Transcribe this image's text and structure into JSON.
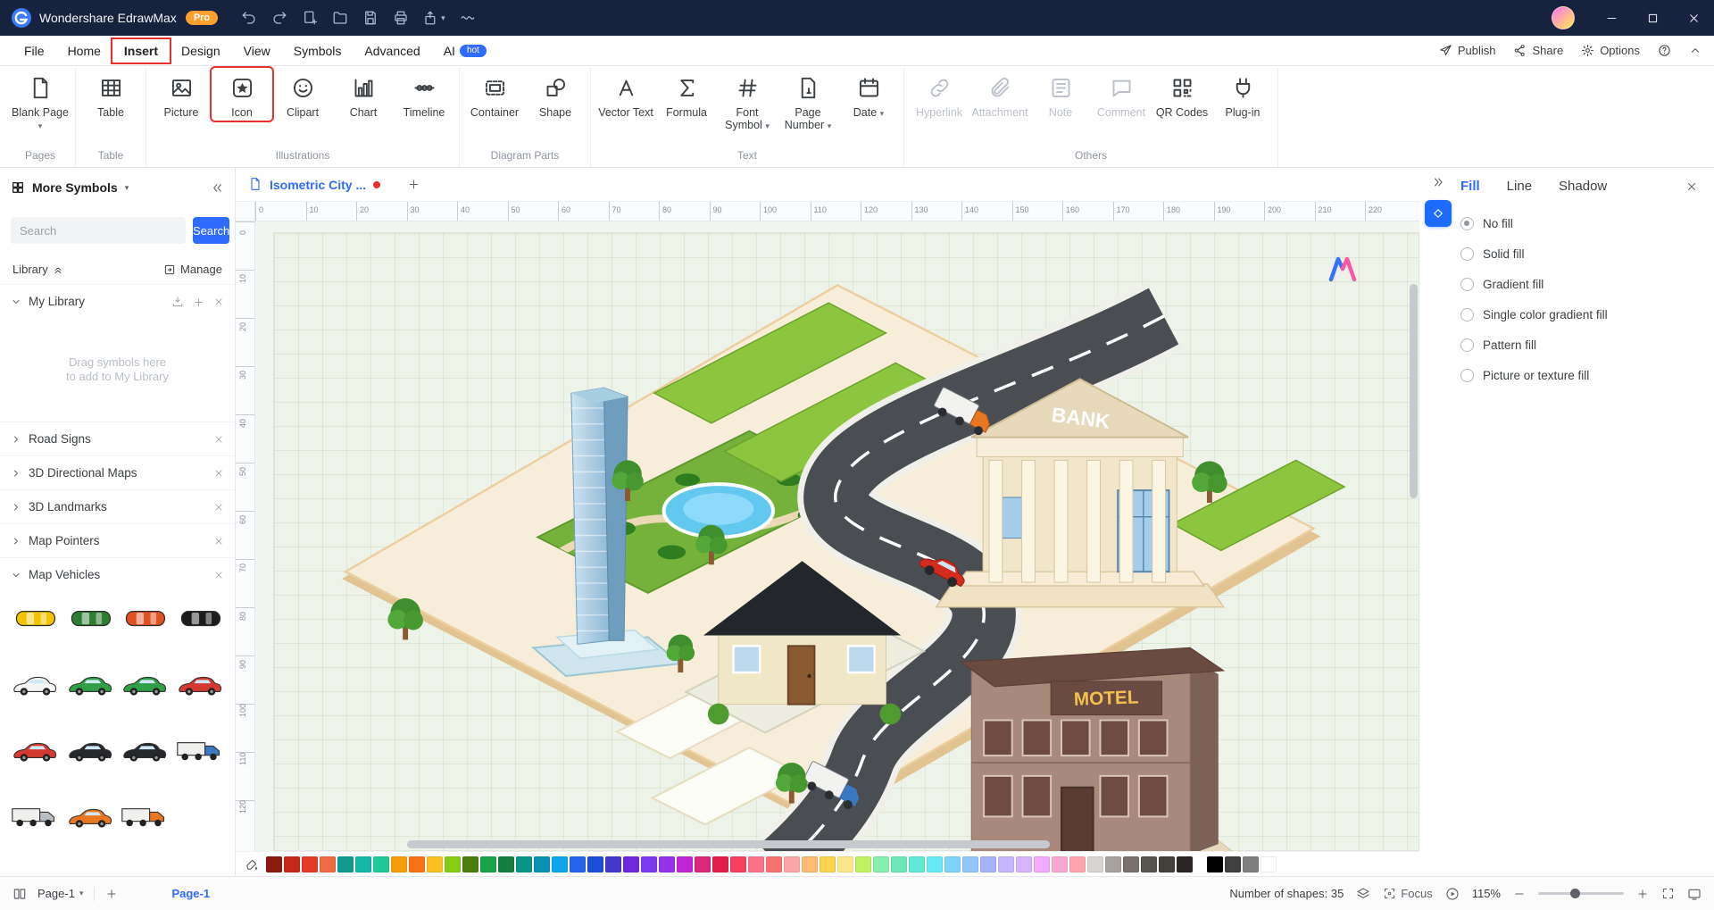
{
  "titlebar": {
    "app_name": "Wondershare EdrawMax",
    "pro_badge": "Pro",
    "icons": [
      "undo",
      "redo",
      "new-page",
      "open-folder",
      "save",
      "print",
      "export",
      "customize"
    ],
    "window_icons": [
      "minimize",
      "maximize",
      "close"
    ]
  },
  "menubar": {
    "items": [
      {
        "label": "File"
      },
      {
        "label": "Home"
      },
      {
        "label": "Insert",
        "highlighted": true
      },
      {
        "label": "Design"
      },
      {
        "label": "View"
      },
      {
        "label": "Symbols"
      },
      {
        "label": "Advanced"
      },
      {
        "label": "AI",
        "badge": "hot"
      }
    ],
    "right": [
      {
        "label": "Publish",
        "icon": "publish"
      },
      {
        "label": "Share",
        "icon": "share"
      },
      {
        "label": "Options",
        "icon": "gear"
      }
    ]
  },
  "ribbon": {
    "groups": [
      {
        "label": "Pages",
        "buttons": [
          {
            "label": "Blank Page",
            "icon": "blank-page",
            "dropdown": true
          }
        ]
      },
      {
        "label": "Table",
        "buttons": [
          {
            "label": "Table",
            "icon": "table"
          }
        ]
      },
      {
        "label": "Illustrations",
        "buttons": [
          {
            "label": "Picture",
            "icon": "picture"
          },
          {
            "label": "Icon",
            "icon": "icon-star",
            "highlighted": true
          },
          {
            "label": "Clipart",
            "icon": "clipart"
          },
          {
            "label": "Chart",
            "icon": "chart"
          },
          {
            "label": "Timeline",
            "icon": "timeline"
          }
        ]
      },
      {
        "label": "Diagram Parts",
        "buttons": [
          {
            "label": "Container",
            "icon": "container"
          },
          {
            "label": "Shape",
            "icon": "shape"
          }
        ]
      },
      {
        "label": "Text",
        "buttons": [
          {
            "label": "Vector Text",
            "icon": "vector-text"
          },
          {
            "label": "Formula",
            "icon": "formula"
          },
          {
            "label": "Font Symbol",
            "icon": "font-symbol",
            "dropdown": true
          },
          {
            "label": "Page Number",
            "icon": "page-number",
            "dropdown": true
          },
          {
            "label": "Date",
            "icon": "date",
            "dropdown": true
          }
        ]
      },
      {
        "label": "Others",
        "buttons": [
          {
            "label": "Hyperlink",
            "icon": "hyperlink",
            "disabled": true
          },
          {
            "label": "Attachment",
            "icon": "attachment",
            "disabled": true
          },
          {
            "label": "Note",
            "icon": "note",
            "disabled": true
          },
          {
            "label": "Comment",
            "icon": "comment",
            "disabled": true
          },
          {
            "label": "QR Codes",
            "icon": "qr-codes"
          },
          {
            "label": "Plug-in",
            "icon": "plug-in"
          }
        ]
      }
    ]
  },
  "sidebar": {
    "title": "More Symbols",
    "search_placeholder": "Search",
    "search_button": "Search",
    "library_label": "Library",
    "manage_label": "Manage",
    "sections": [
      {
        "label": "My Library",
        "expanded": true,
        "type": "my-library",
        "drop_hint": "Drag symbols here to add to My Library"
      },
      {
        "label": "Road Signs",
        "expanded": false
      },
      {
        "label": "3D Directional Maps",
        "expanded": false
      },
      {
        "label": "3D Landmarks",
        "expanded": false
      },
      {
        "label": "Map Pointers",
        "expanded": false
      },
      {
        "label": "Map Vehicles",
        "expanded": true,
        "type": "vehicles"
      }
    ],
    "vehicles": [
      {
        "view": "top",
        "color": "#f2c500"
      },
      {
        "view": "top",
        "color": "#2e7d32"
      },
      {
        "view": "top",
        "color": "#e05020"
      },
      {
        "view": "top",
        "color": "#1c1c1c"
      },
      {
        "view": "side",
        "color": "#f5f5f5"
      },
      {
        "view": "side",
        "color": "#2f9e44"
      },
      {
        "view": "side",
        "color": "#2f9e44"
      },
      {
        "view": "side",
        "color": "#d43a2f"
      },
      {
        "view": "side",
        "color": "#d43a2f"
      },
      {
        "view": "side",
        "color": "#26282c"
      },
      {
        "view": "side",
        "color": "#26282c"
      },
      {
        "view": "truck",
        "color": "#3a78c2"
      },
      {
        "view": "truck",
        "color": "#b9bec4"
      },
      {
        "view": "side",
        "color": "#e87722"
      },
      {
        "view": "truck",
        "color": "#e87722"
      }
    ]
  },
  "canvas": {
    "tab_title": "Isometric City ...",
    "ruler_h": {
      "start": 0,
      "end": 220,
      "step": 10
    },
    "ruler_v": {
      "start": 0,
      "end": 120,
      "step": 10
    },
    "bank_label": "BANK",
    "motel_label": "MOTEL"
  },
  "fill_panel": {
    "tabs": [
      {
        "label": "Fill",
        "active": true
      },
      {
        "label": "Line"
      },
      {
        "label": "Shadow"
      }
    ],
    "options": [
      {
        "label": "No fill",
        "selected": true
      },
      {
        "label": "Solid fill"
      },
      {
        "label": "Gradient fill"
      },
      {
        "label": "Single color gradient fill"
      },
      {
        "label": "Pattern fill"
      },
      {
        "label": "Picture or texture fill"
      }
    ]
  },
  "palette": {
    "colors": [
      "#8b1a10",
      "#c62817",
      "#e23c25",
      "#ef6a45",
      "#0f9b8e",
      "#14b8a6",
      "#20c997",
      "#f59e0b",
      "#f97316",
      "#fbbf24",
      "#84cc16",
      "#4d7c0f",
      "#16a34a",
      "#15803d",
      "#0d9488",
      "#0891b2",
      "#0ea5e9",
      "#2563eb",
      "#1d4ed8",
      "#4338ca",
      "#6d28d9",
      "#7c3aed",
      "#9333ea",
      "#c026d3",
      "#db2777",
      "#e11d48",
      "#f43f5e",
      "#fb7185",
      "#f87171",
      "#fca5a5",
      "#fdba74",
      "#fcd34d",
      "#fde68a",
      "#bef264",
      "#86efac",
      "#6ee7b7",
      "#5eead4",
      "#67e8f9",
      "#7dd3fc",
      "#93c5fd",
      "#a5b4fc",
      "#c4b5fd",
      "#d8b4fe",
      "#f0abfc",
      "#f9a8d4",
      "#fda4af",
      "#d6d3d1",
      "#a8a29e",
      "#78716c",
      "#57534e",
      "#44403c",
      "#292524"
    ],
    "grays": [
      "#000000",
      "#3f3f3f",
      "#7f7f7f",
      "#ffffff"
    ]
  },
  "statusbar": {
    "page_selector": "Page-1",
    "page_tab": "Page-1",
    "shapes_count_label": "Number of shapes: 35",
    "focus_label": "Focus",
    "zoom_level": "115%"
  }
}
